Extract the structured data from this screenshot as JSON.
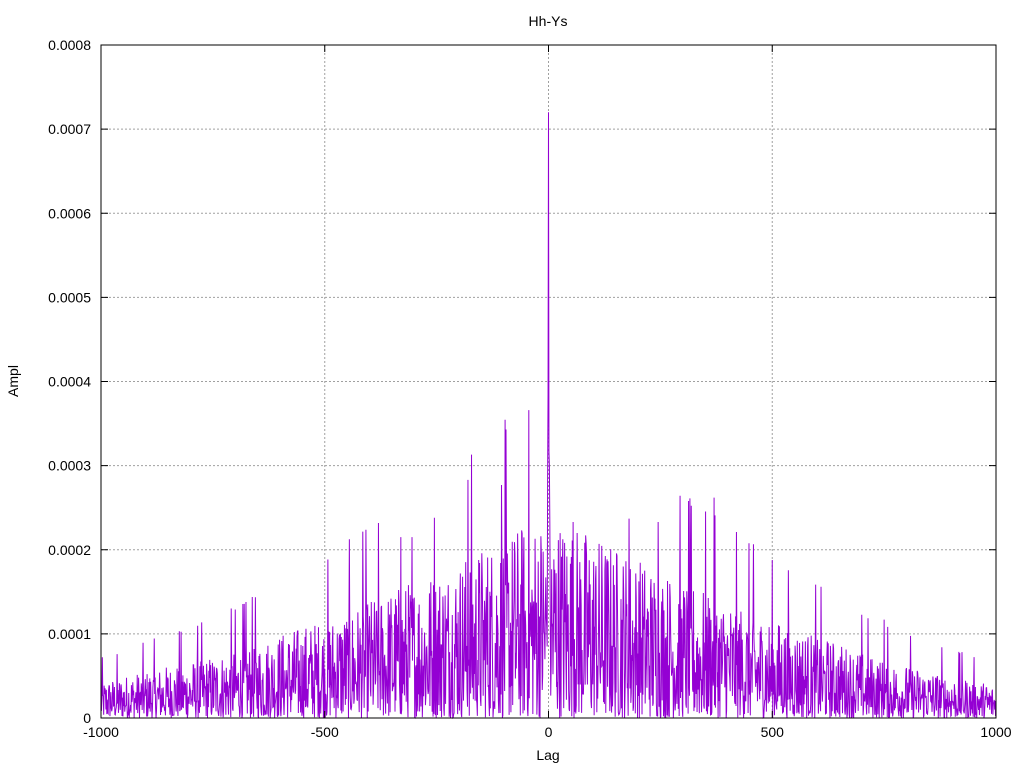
{
  "chart_data": {
    "type": "line",
    "title": "Hh-Ys",
    "xlabel": "Lag",
    "ylabel": "Ampl",
    "xlim": [
      -1000,
      1000
    ],
    "ylim": [
      0,
      0.0008
    ],
    "grid": true,
    "x_ticks": [
      "-1000",
      "-500",
      "0",
      "500",
      "1000"
    ],
    "y_ticks": [
      "0",
      "0.0001",
      "0.0002",
      "0.0003",
      "0.0004",
      "0.0005",
      "0.0006",
      "0.0007",
      "0.0008"
    ],
    "series": [
      {
        "color": "#9400d3",
        "peak": {
          "x": 0,
          "y": 0.00072
        },
        "notable_peaks": [
          {
            "x": -180,
            "y": 0.000283
          },
          {
            "x": -105,
            "y": 0.000277
          },
          {
            "x": 370,
            "y": 0.000262
          },
          {
            "x": -255,
            "y": 0.000238
          },
          {
            "x": 180,
            "y": 0.000237
          },
          {
            "x": 55,
            "y": 0.000233
          },
          {
            "x": 245,
            "y": 0.000233
          },
          {
            "x": -305,
            "y": 0.000215
          },
          {
            "x": -330,
            "y": 0.000215
          },
          {
            "x": 750,
            "y": 0.000117
          }
        ],
        "envelope": [
          {
            "x": -1000,
            "y": 4.5e-05
          },
          {
            "x": -750,
            "y": 7.5e-05
          },
          {
            "x": -500,
            "y": 0.00012
          },
          {
            "x": -250,
            "y": 0.00018
          },
          {
            "x": 0,
            "y": 0.00025
          },
          {
            "x": 250,
            "y": 0.00018
          },
          {
            "x": 500,
            "y": 0.00012
          },
          {
            "x": 750,
            "y": 7e-05
          },
          {
            "x": 1000,
            "y": 4e-05
          }
        ]
      }
    ]
  }
}
